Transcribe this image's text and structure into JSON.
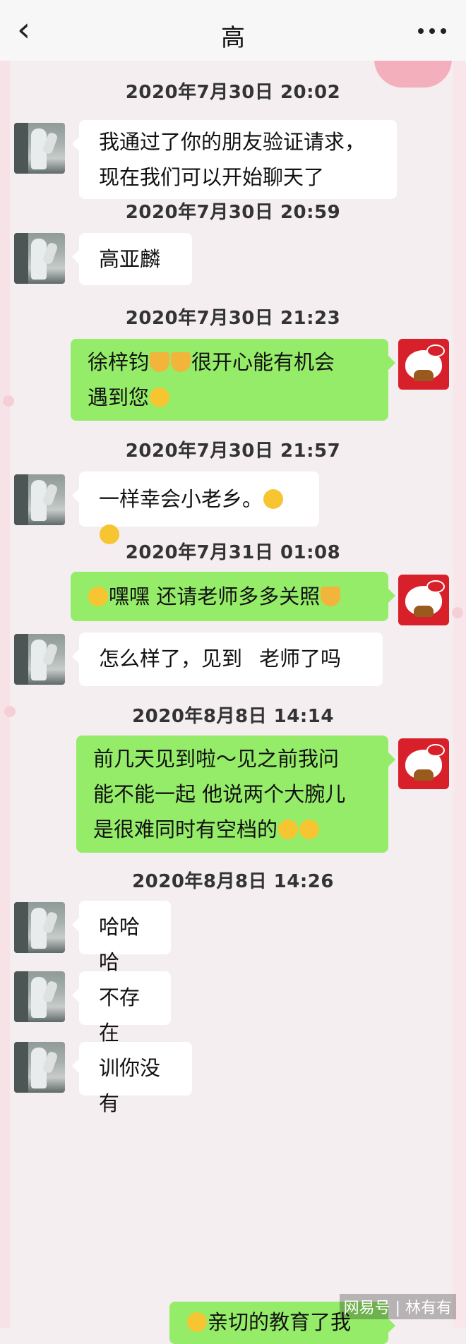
{
  "header": {
    "back_icon": "chevron-left-icon",
    "title": "高",
    "more_icon": "more-dots-icon"
  },
  "messages": [
    {
      "ts": "2020年7月30日 20:02",
      "text": "我通过了你的朋友验证请求，\n现在我们可以开始聊天了"
    },
    {
      "ts": "2020年7月30日 20:59",
      "text": "高亚麟"
    },
    {
      "ts": "2020年7月30日 21:23",
      "text_a": "徐梓钧",
      "text_b": "很开心能有机会",
      "text_c": "遇到您"
    },
    {
      "ts": "2020年7月30日 21:57",
      "text": "一样幸会小老乡。"
    },
    {
      "ts": "2020年7月31日 01:08",
      "text": "嘿嘿 还请老师多多关照"
    },
    {
      "text_a": "怎么样了，见到",
      "text_b": "老师了吗"
    },
    {
      "ts": "2020年8月8日 14:14",
      "text_a": "前几天见到啦～见之前我问\n能不能一起 他说两个大腕儿\n是很难同时有空档的"
    },
    {
      "ts": "2020年8月8日 14:26",
      "text": "哈哈哈"
    },
    {
      "text": "不存在"
    },
    {
      "text": "训你没有"
    },
    {
      "text": "亲切的教育了我"
    }
  ],
  "watermark": "网易号 | 林有有",
  "colors": {
    "sent_bubble": "#95ec69",
    "received_bubble": "#ffffff",
    "header_bg": "#f7f7f7"
  }
}
